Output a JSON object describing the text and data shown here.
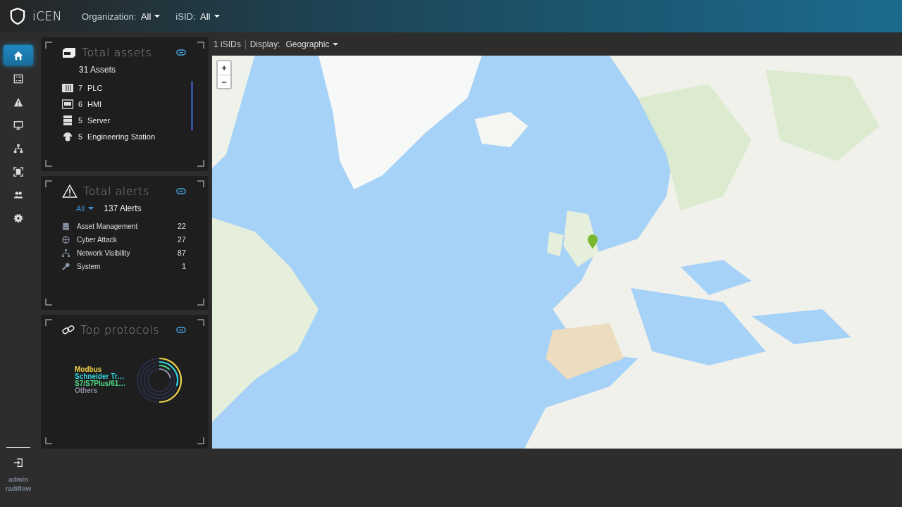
{
  "app": {
    "name": "iCEN"
  },
  "filters": [
    {
      "label": "Organization:",
      "value": "All"
    },
    {
      "label": "iSID:",
      "value": "All"
    }
  ],
  "nav": [
    {
      "kind": "home",
      "selected": true
    },
    {
      "kind": "list",
      "selected": false
    },
    {
      "kind": "alert",
      "selected": false
    },
    {
      "kind": "monitor",
      "selected": false
    },
    {
      "kind": "network",
      "selected": false
    },
    {
      "kind": "scan",
      "selected": false
    },
    {
      "kind": "users",
      "selected": false
    },
    {
      "kind": "settings",
      "selected": false
    }
  ],
  "user": {
    "name": "admin",
    "org": "radiflow"
  },
  "assets": {
    "title": "Total assets",
    "total": "31 Assets",
    "items": [
      {
        "kind": "plc",
        "count": "7",
        "label": "PLC"
      },
      {
        "kind": "hmi",
        "count": "6",
        "label": "HMI"
      },
      {
        "kind": "server",
        "count": "5",
        "label": "Server"
      },
      {
        "kind": "engineering",
        "count": "5",
        "label": "Engineering Station"
      }
    ]
  },
  "alerts": {
    "title": "Total alerts",
    "filter": "All",
    "total": "137 Alerts",
    "items": [
      {
        "kind": "database",
        "label": "Asset Management",
        "count": "22"
      },
      {
        "kind": "crosshair",
        "label": "Cyber Attack",
        "count": "27"
      },
      {
        "kind": "network",
        "label": "Network Visibility",
        "count": "87"
      },
      {
        "kind": "wrench",
        "label": "System",
        "count": "1"
      }
    ]
  },
  "protocols": {
    "title": "Top protocols",
    "items": [
      {
        "label": "Modbus",
        "color": "#f0d24a"
      },
      {
        "label": "Schneider Tr…",
        "color": "#2fd6e0"
      },
      {
        "label": "S7/S7Plus/61…",
        "color": "#4ed98a"
      },
      {
        "label": "Others",
        "color": "#8a8aa0"
      }
    ]
  },
  "map_header": {
    "count": "1 iSIDs",
    "display_label": "Display:",
    "display_value": "Geographic"
  },
  "map": {
    "kind": "picture",
    "zoom_in": "+",
    "zoom_out": "−"
  }
}
